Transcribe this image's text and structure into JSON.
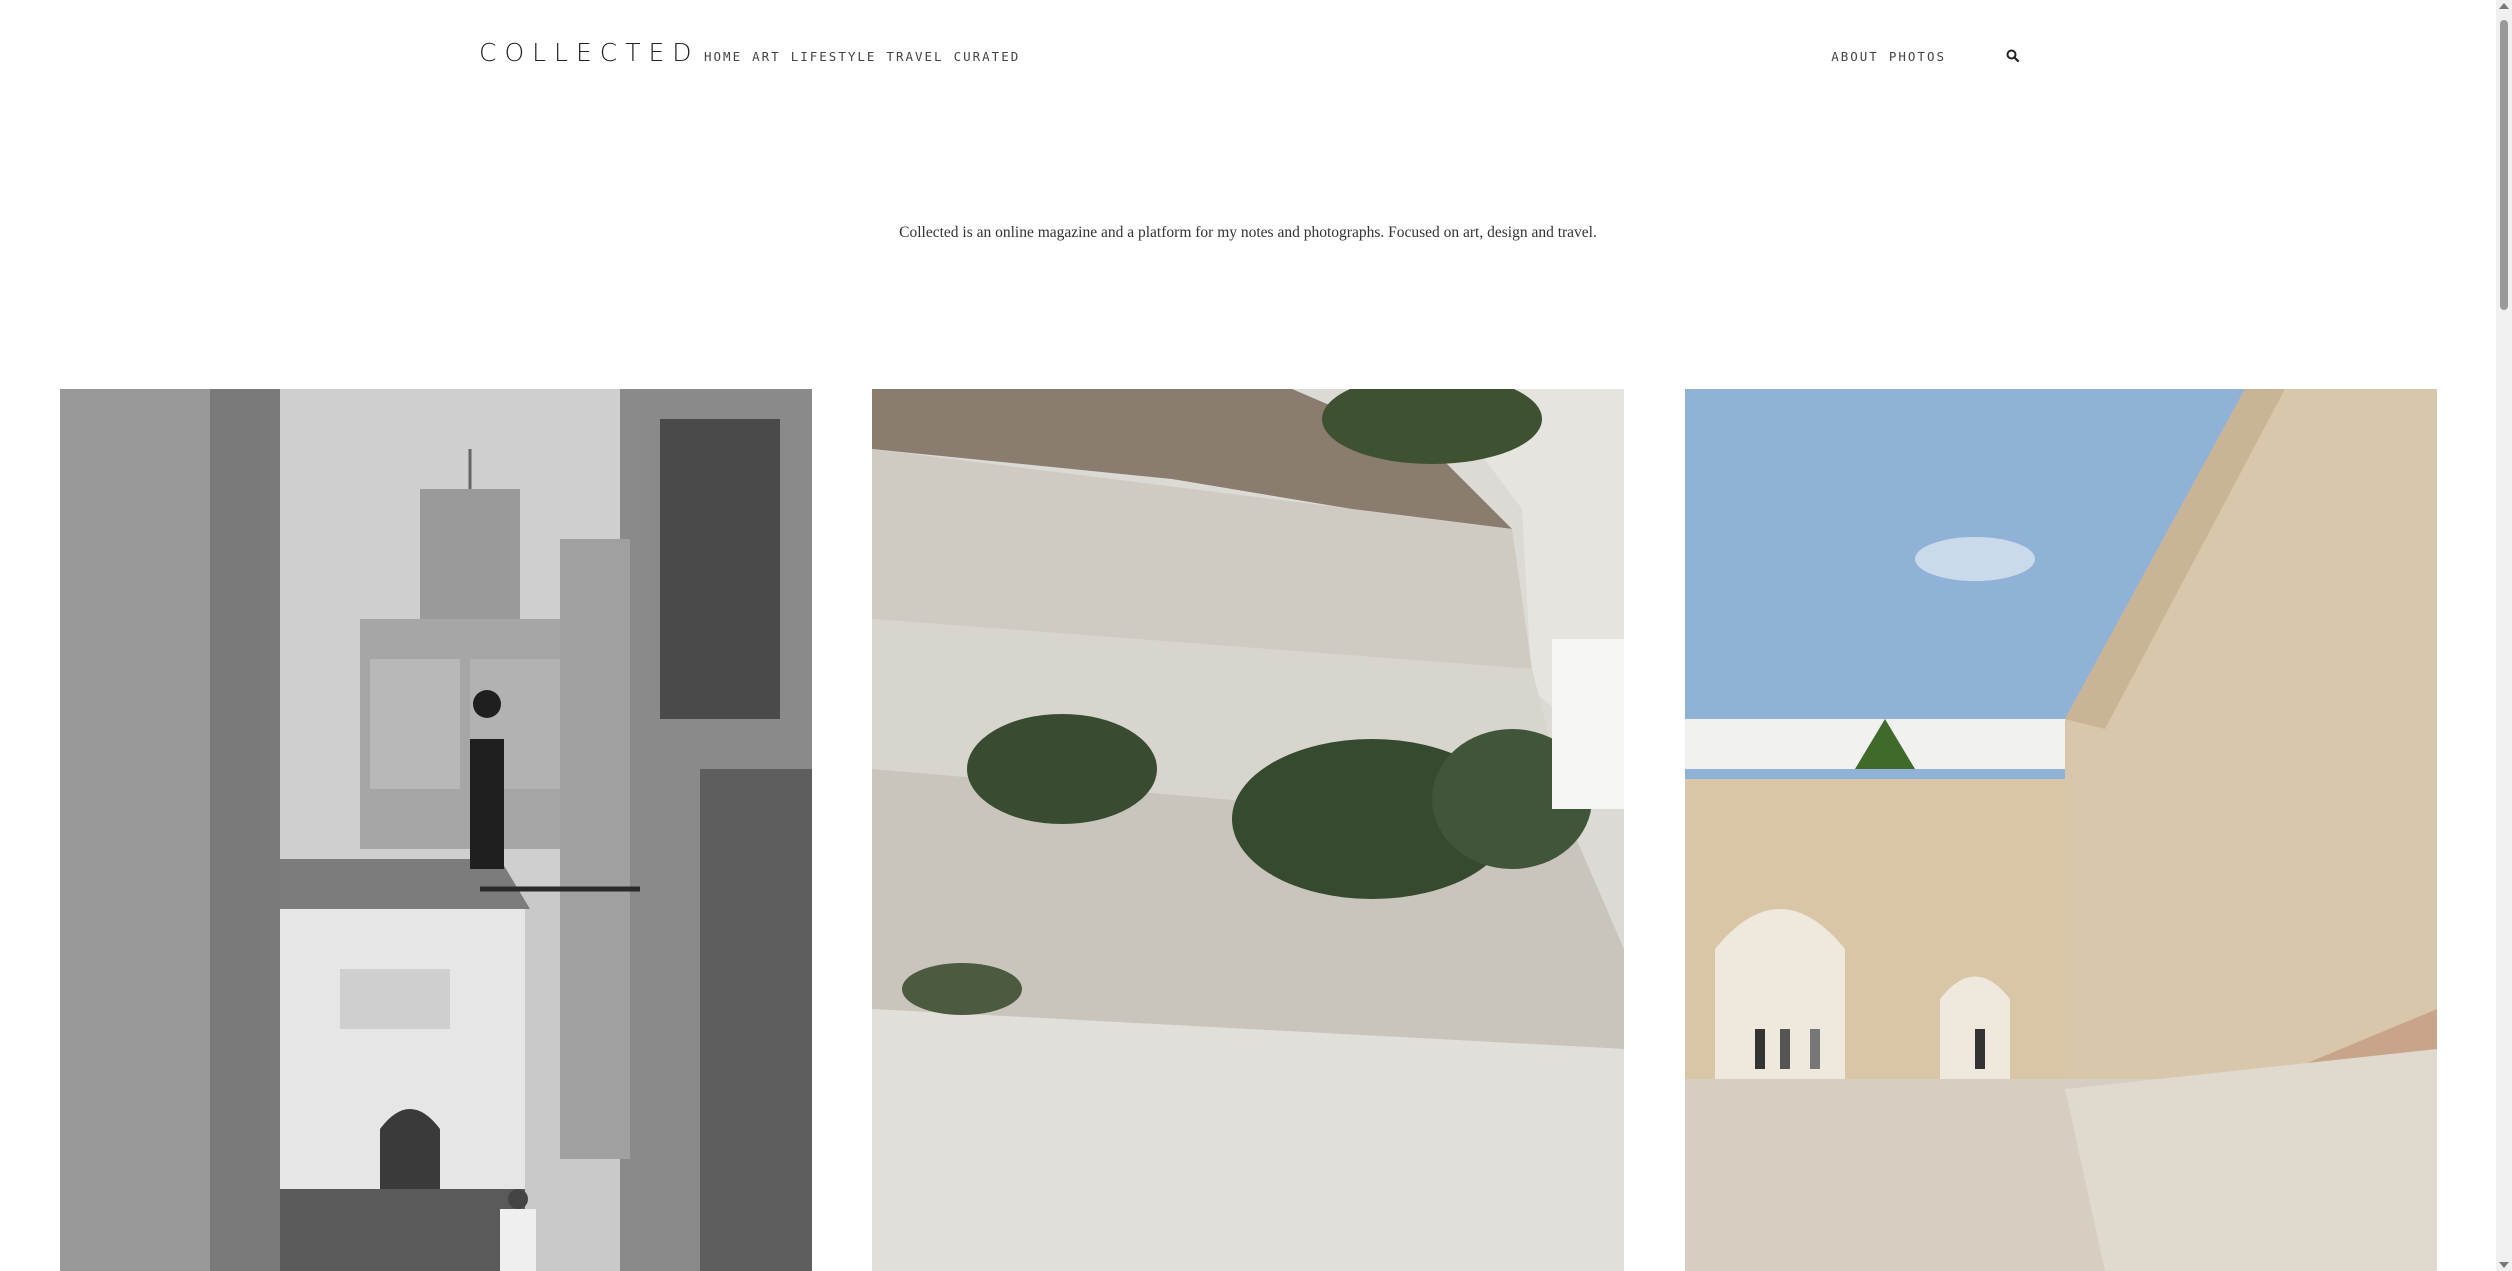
{
  "site": {
    "logo": "COLLECTED"
  },
  "nav": {
    "primary": [
      {
        "label": "HOME"
      },
      {
        "label": "ART"
      },
      {
        "label": "LIFESTYLE"
      },
      {
        "label": "TRAVEL"
      },
      {
        "label": "CURATED"
      }
    ],
    "secondary": [
      {
        "label": "ABOUT"
      },
      {
        "label": "PHOTOS"
      }
    ],
    "search_icon": "search-icon"
  },
  "intro": {
    "tagline": "Collected is an online magazine and a platform for my notes and photographs. Focused on art, design and travel."
  },
  "gallery": [
    {
      "subject": "monochrome medina alley with minaret and street lamp"
    },
    {
      "subject": "white limestone cliff with green shrubs"
    },
    {
      "subject": "ochre city wall with arched gates under blue sky"
    }
  ],
  "colors": {
    "background": "#ffffff",
    "text": "#222222",
    "sky": "#8fb2d6",
    "wall": "#d8c7aa"
  }
}
